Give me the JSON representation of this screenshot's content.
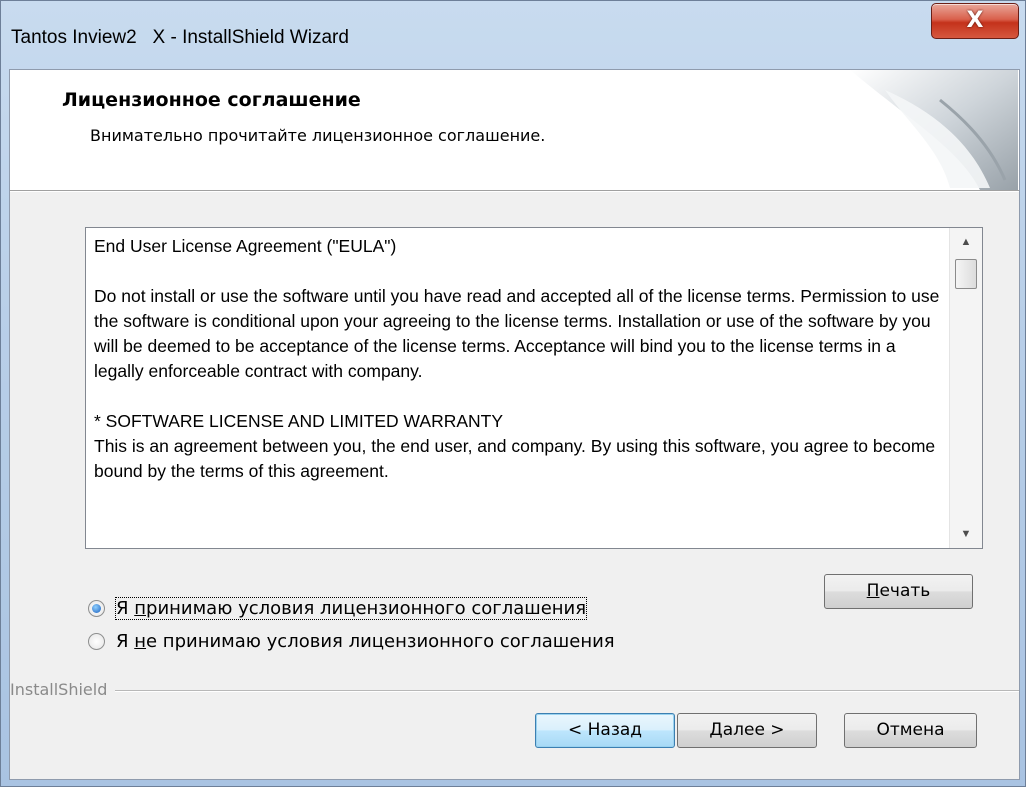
{
  "window": {
    "title": "Tantos Inview2   X - InstallShield Wizard",
    "close_glyph": "X"
  },
  "header": {
    "title": "Лицензионное соглашение",
    "subtitle": "Внимательно прочитайте лицензионное соглашение."
  },
  "eula": {
    "paragraphs": [
      "End User License Agreement (\"EULA\")",
      "Do not install or use the software until you have read and accepted all of the license terms. Permission to use the software is conditional upon your agreeing to the license terms. Installation or use of the software by you will be deemed to be acceptance of the license terms. Acceptance will bind you to the license terms in a legally enforceable contract with company.",
      "* SOFTWARE LICENSE AND LIMITED WARRANTY",
      "This is an agreement between you, the end user, and company. By using this software, you agree to become bound by the terms of this agreement."
    ],
    "scroll_up_icon": "scroll-up-arrow",
    "scroll_down_icon": "scroll-down-arrow"
  },
  "options": {
    "accept": {
      "prefix": "Я ",
      "accel": "п",
      "rest": "ринимаю условия лицензионного соглашения",
      "checked": true
    },
    "decline": {
      "prefix": "Я ",
      "accel": "н",
      "rest": "е принимаю условия лицензионного соглашения",
      "checked": false
    }
  },
  "buttons": {
    "print": {
      "accel": "П",
      "rest": "ечать"
    },
    "back": "< Назад",
    "next": {
      "accel": "Д",
      "rest": "алее >"
    },
    "cancel": "Отмена"
  },
  "branding": "InstallShield",
  "colors": {
    "close_button": "#c4321b",
    "radio_selected": "#1b5fbd",
    "default_button_border": "#3c7fb1"
  }
}
